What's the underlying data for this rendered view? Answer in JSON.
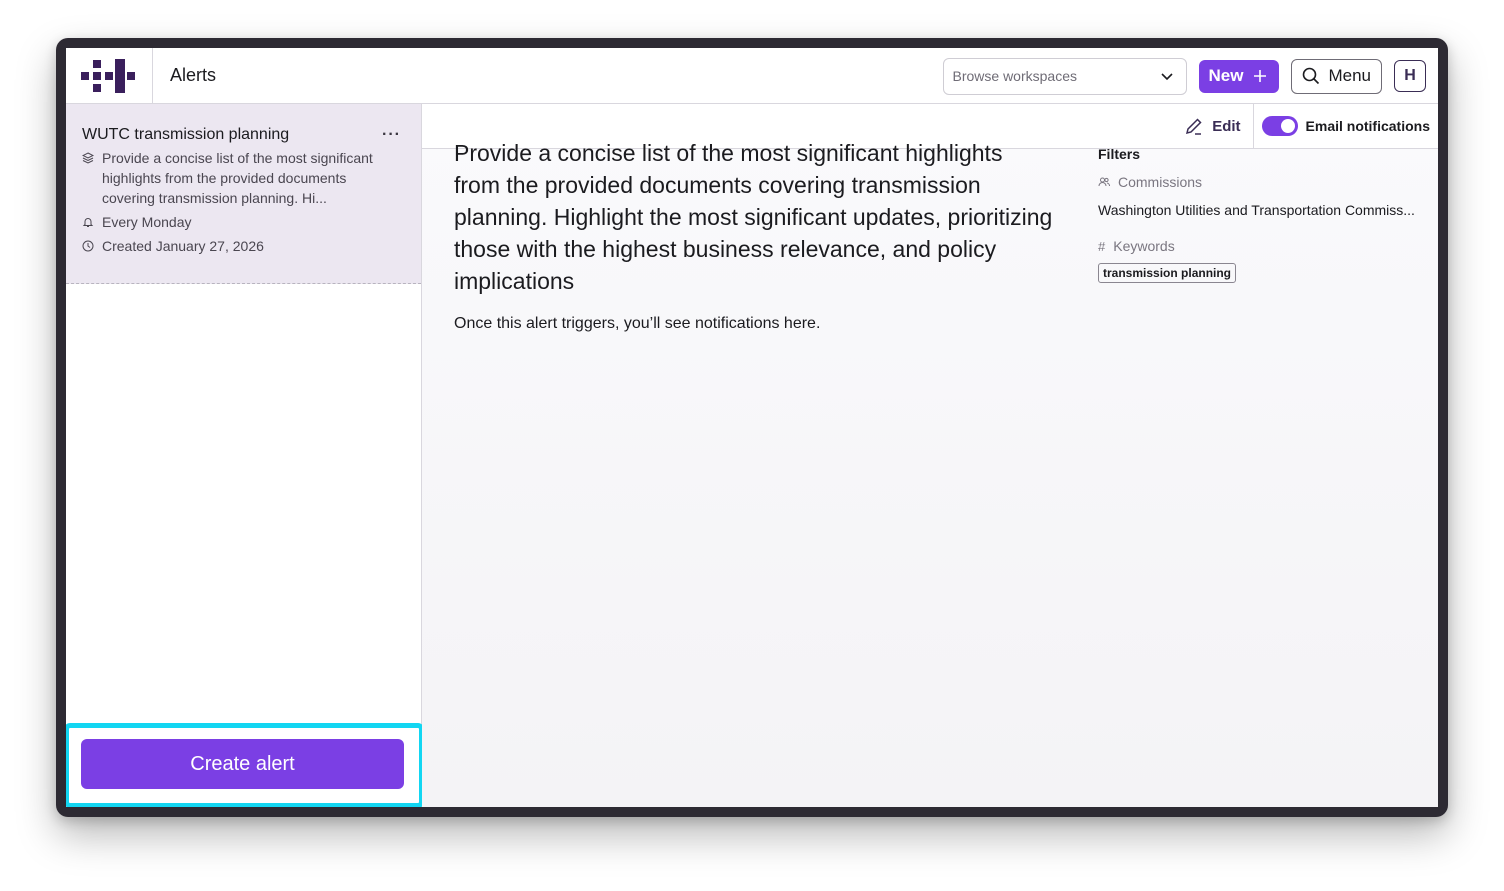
{
  "header": {
    "title": "Alerts",
    "workspace_placeholder": "Browse workspaces",
    "new_label": "New",
    "menu_label": "Menu",
    "avatar_initial": "H"
  },
  "sidebar": {
    "alert": {
      "title": "WUTC transmission planning",
      "description": "Provide a concise list of the most significant highlights from the provided documents covering transmission planning. Hi...",
      "schedule": "Every Monday",
      "created": "Created January 27, 2026"
    },
    "create_label": "Create alert"
  },
  "toolbar": {
    "edit_label": "Edit",
    "notifications_label": "Email notifications",
    "notifications_on": true
  },
  "main": {
    "prompt": "Provide a concise list of the most significant highlights from the provided documents covering transmission planning. Highlight the most significant updates, prioritizing those with the highest business relevance, and policy implications",
    "empty_message": "Once this alert triggers, you’ll see notifications here."
  },
  "filters": {
    "title": "Filters",
    "commissions_label": "Commissions",
    "commissions_value": "Washington Utilities and Transportation Commiss...",
    "keywords_label": "Keywords",
    "keywords": [
      "transmission planning"
    ]
  },
  "colors": {
    "accent": "#7b3fe4",
    "card_bg": "#ece7f1",
    "highlight": "#12d6f2"
  }
}
